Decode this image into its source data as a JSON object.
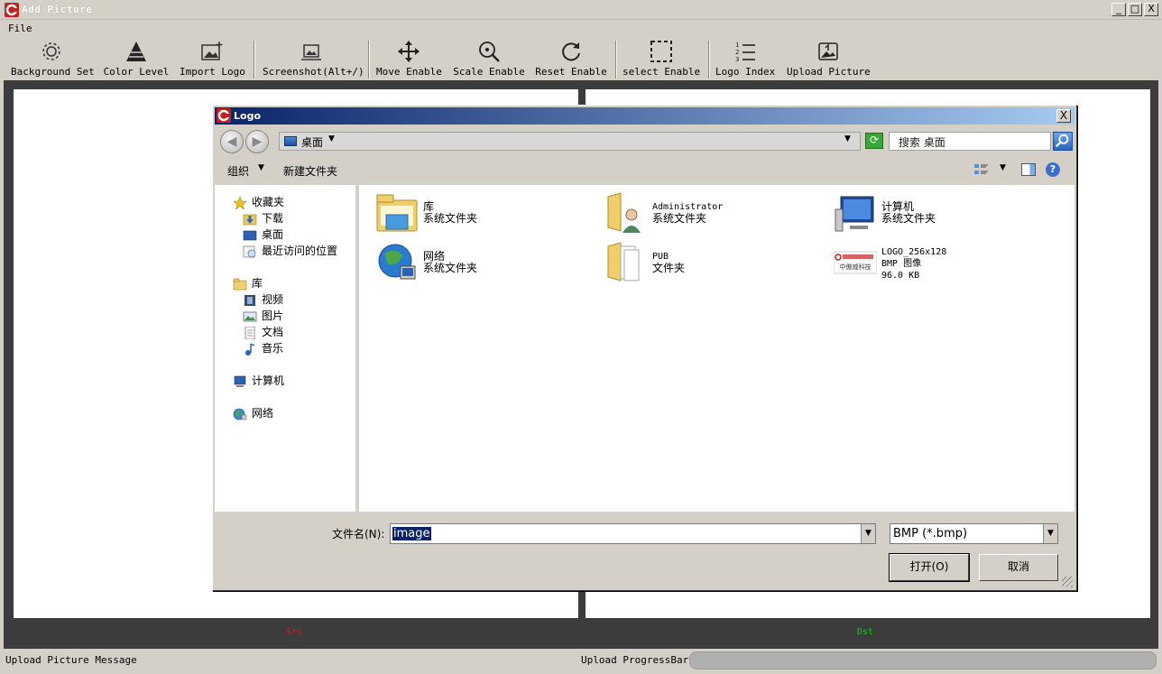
{
  "window": {
    "title": "Add Picture",
    "min": "_",
    "max": "□",
    "close": "X"
  },
  "menu": {
    "file": "File"
  },
  "toolbar": {
    "background_set": "Background Set",
    "color_level": "Color Level",
    "import_logo": "Import Logo",
    "screenshot": "Screenshot(Alt+/)",
    "move_enable": "Move Enable",
    "scale_enable": "Scale Enable",
    "reset_enable": "Reset Enable",
    "select_enable": "select Enable",
    "logo_index": "Logo Index",
    "upload_picture": "Upload Picture"
  },
  "panels": {
    "src": "Src",
    "dst": "Dst"
  },
  "status": {
    "message": "Upload Picture Message",
    "progress_label": "Upload ProgressBar:",
    "progress": 0
  },
  "dialog": {
    "title": "Logo",
    "close": "X",
    "address": {
      "current": "桌面",
      "search_placeholder": "搜索 桌面"
    },
    "commands": {
      "organize": "组织",
      "new_folder": "新建文件夹"
    },
    "nav": {
      "favorites": "收藏夹",
      "downloads": "下载",
      "desktop": "桌面",
      "recent": "最近访问的位置",
      "libraries": "库",
      "videos": "视频",
      "pictures": "图片",
      "documents": "文档",
      "music": "音乐",
      "computer": "计算机",
      "network": "网络"
    },
    "files": [
      {
        "name": "库",
        "sub": "系统文件夹"
      },
      {
        "name": "Administrator",
        "sub": "系统文件夹"
      },
      {
        "name": "计算机",
        "sub": "系统文件夹"
      },
      {
        "name": "网络",
        "sub": "系统文件夹"
      },
      {
        "name": "PUB",
        "sub": "文件夹"
      },
      {
        "name": "LOGO_256x128",
        "sub": "BMP 图像",
        "size": "96.0 KB",
        "thumb_text": "中傲威科技"
      }
    ],
    "filename_label": "文件名(N):",
    "filename_value": "image",
    "filetype": "BMP (*.bmp)",
    "open": "打开(O)",
    "cancel": "取消"
  },
  "colors": {
    "dialog_title_start": "#0a246a",
    "dialog_title_end": "#a6caf0",
    "src": "#d02020",
    "dst": "#20c020"
  }
}
